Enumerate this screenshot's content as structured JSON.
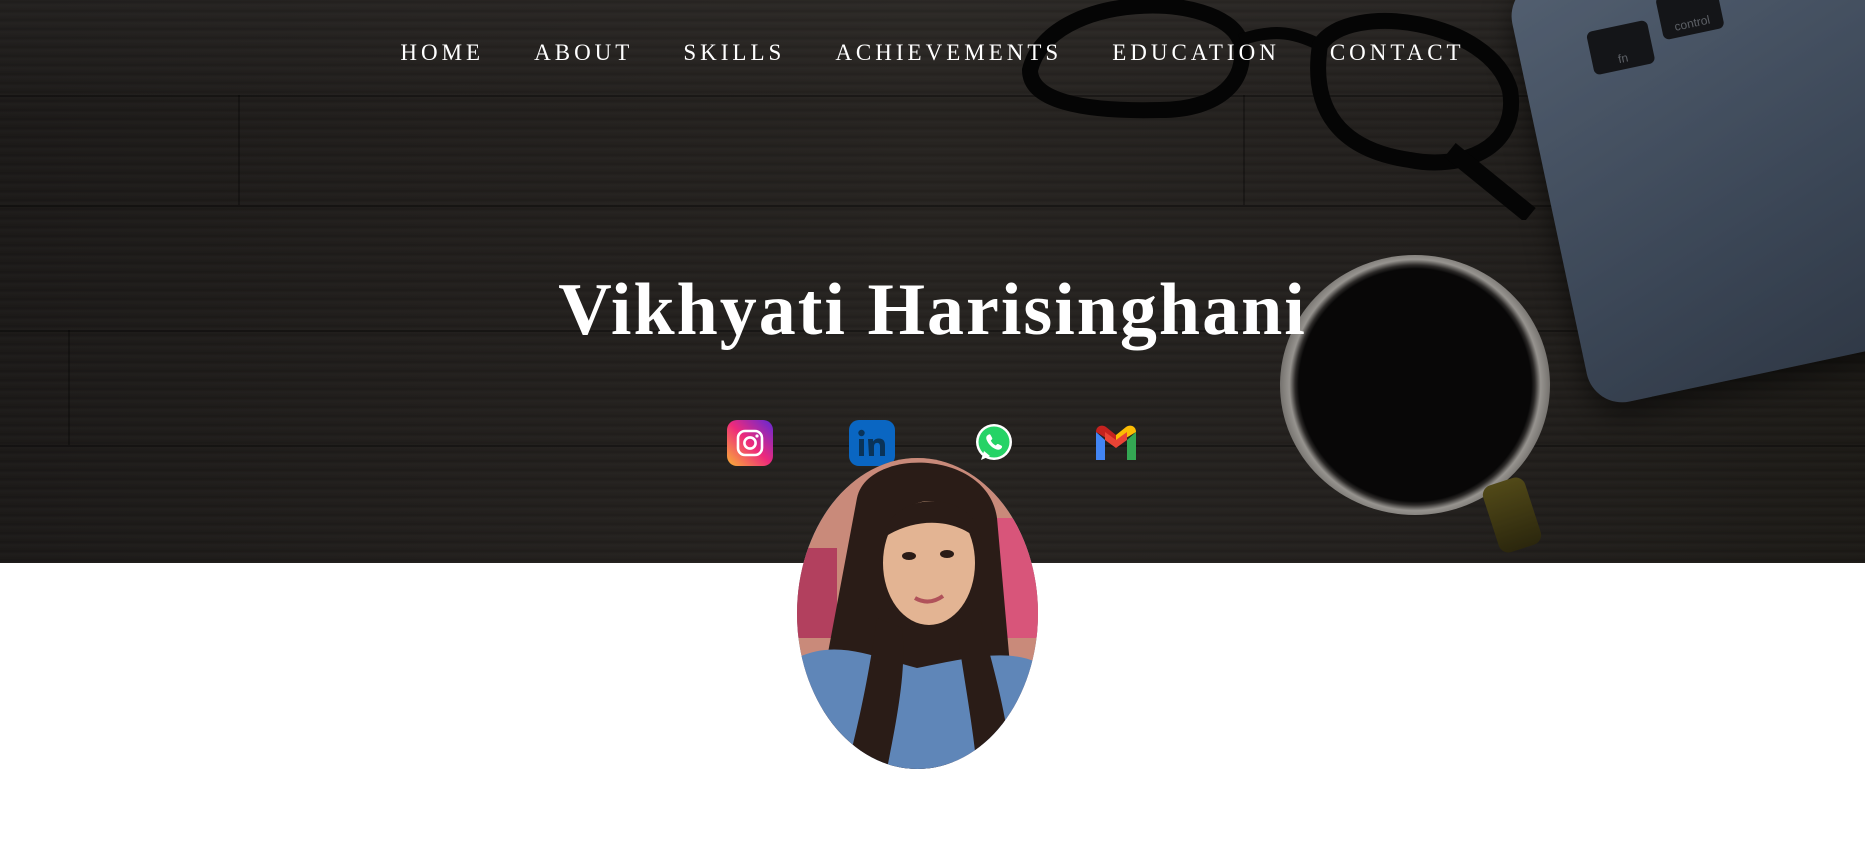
{
  "nav": {
    "items": [
      {
        "label": "HOME"
      },
      {
        "label": "ABOUT"
      },
      {
        "label": "SKILLS"
      },
      {
        "label": "ACHIEVEMENTS"
      },
      {
        "label": "EDUCATION"
      },
      {
        "label": "CONTACT"
      }
    ]
  },
  "hero": {
    "title": "Vikhyati Harisinghani"
  },
  "social": [
    {
      "icon": "instagram-icon"
    },
    {
      "icon": "linkedin-icon"
    },
    {
      "icon": "whatsapp-icon"
    },
    {
      "icon": "gmail-icon"
    }
  ],
  "decor": {
    "laptop_keys": [
      "fn",
      "control"
    ]
  },
  "colors": {
    "nav_text": "#ffffff",
    "title_text": "#ffffff",
    "page_bg": "#ffffff"
  }
}
